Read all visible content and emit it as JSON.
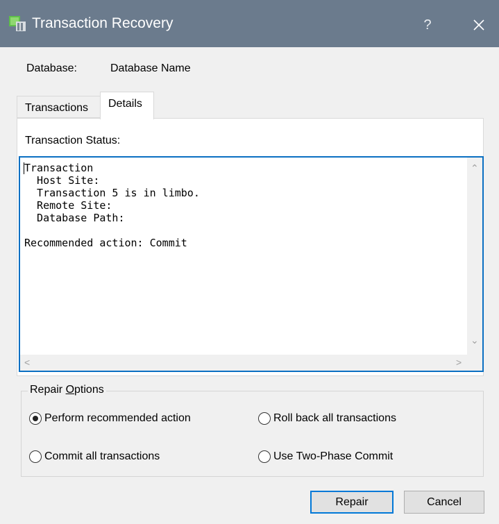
{
  "window": {
    "title": "Transaction Recovery",
    "help_label": "?",
    "icons": {
      "app": "database-app-icon",
      "close": "close-icon"
    }
  },
  "database": {
    "label": "Database:",
    "value": "Database Name"
  },
  "tabs": [
    {
      "label": "Transactions",
      "active": false
    },
    {
      "label": "Details",
      "active": true
    }
  ],
  "details": {
    "status_label": "Transaction Status:",
    "status_text": "Transaction\n  Host Site:\n  Transaction 5 is in limbo.\n  Remote Site:\n  Database Path:\n\nRecommended action: Commit"
  },
  "repair_options": {
    "legend_prefix": "Repair ",
    "legend_accel": "O",
    "legend_suffix": "ptions",
    "options": [
      {
        "label": "Perform recommended action",
        "checked": true
      },
      {
        "label": "Roll back all transactions",
        "checked": false
      },
      {
        "label": "Commit all transactions",
        "checked": false
      },
      {
        "label": "Use Two-Phase Commit",
        "checked": false
      }
    ]
  },
  "buttons": {
    "repair": "Repair",
    "cancel": "Cancel"
  },
  "colors": {
    "titlebar": "#6b7b8d",
    "focus": "#0078d7",
    "text_focus_border": "#0a6fc2"
  }
}
